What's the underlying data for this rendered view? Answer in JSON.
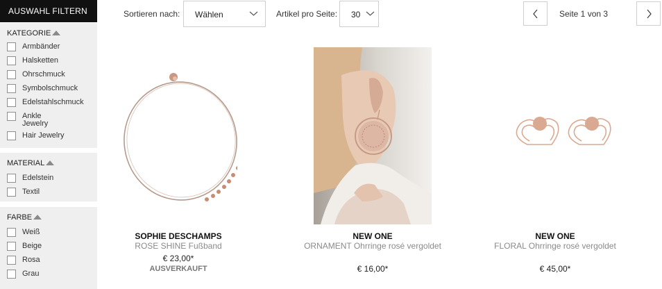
{
  "sidebar": {
    "header": "AUSWAHL FILTERN",
    "kategorie": {
      "title": "KATEGORIE",
      "items": [
        "Armbänder",
        "Halsketten",
        "Ohrschmuck",
        "Symbolschmuck",
        "Edelstahlschmuck",
        "Ankle Jewelry",
        "Hair Jewelry"
      ]
    },
    "material": {
      "title": "MATERIAL",
      "items": [
        "Edelstein",
        "Textil"
      ]
    },
    "farbe": {
      "title": "FARBE",
      "items": [
        "Weiß",
        "Beige",
        "Rosa",
        "Grau"
      ]
    }
  },
  "toolbar": {
    "sort_label": "Sortieren nach:",
    "sort_value": "Wählen",
    "per_page_label": "Artikel pro Seite:",
    "per_page_value": "30",
    "page_info": "Seite 1 von 3"
  },
  "products": [
    {
      "brand": "SOPHIE DESCHAMPS",
      "name": "ROSE SHINE Fußband",
      "price": "€ 23,00*",
      "status": "AUSVERKAUFT"
    },
    {
      "brand": "NEW ONE",
      "name": "ORNAMENT Ohrringe rosé vergoldet",
      "price": "€ 16,00*"
    },
    {
      "brand": "NEW ONE",
      "name": "FLORAL Ohrringe rosé vergoldet",
      "price": "€ 45,00*"
    }
  ],
  "colors": {
    "header_bg": "#111111",
    "panel_bg": "#efefef",
    "rose_gold": "#d6a58c"
  }
}
